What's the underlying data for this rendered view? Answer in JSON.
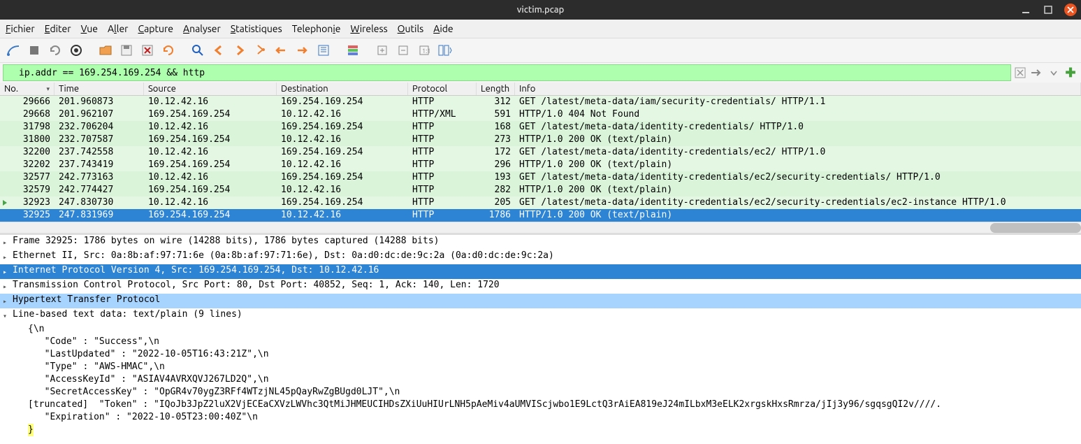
{
  "window": {
    "title": "victim.pcap"
  },
  "menu": {
    "fichier": "Fichier",
    "editer": "Editer",
    "vue": "Vue",
    "aller": "Aller",
    "capture": "Capture",
    "analyser": "Analyser",
    "statistiques": "Statistiques",
    "telephonie": "Telephonie",
    "wireless": "Wireless",
    "outils": "Outils",
    "aide": "Aide"
  },
  "filter": {
    "expression": "ip.addr == 169.254.169.254 && http"
  },
  "columns": {
    "no": "No.",
    "time": "Time",
    "source": "Source",
    "destination": "Destination",
    "protocol": "Protocol",
    "length": "Length",
    "info": "Info"
  },
  "packets": [
    {
      "no": "29666",
      "time": "201.960873",
      "src": "10.12.42.16",
      "dst": "169.254.169.254",
      "proto": "HTTP",
      "len": "312",
      "info": "GET /latest/meta-data/iam/security-credentials/ HTTP/1.1",
      "cls": "row-green"
    },
    {
      "no": "29668",
      "time": "201.962107",
      "src": "169.254.169.254",
      "dst": "10.12.42.16",
      "proto": "HTTP/XML",
      "len": "591",
      "info": "HTTP/1.0 404 Not Found",
      "cls": "row-green"
    },
    {
      "no": "31798",
      "time": "232.706204",
      "src": "10.12.42.16",
      "dst": "169.254.169.254",
      "proto": "HTTP",
      "len": "168",
      "info": "GET /latest/meta-data/identity-credentials/ HTTP/1.0",
      "cls": "row-lgreen"
    },
    {
      "no": "31800",
      "time": "232.707587",
      "src": "169.254.169.254",
      "dst": "10.12.42.16",
      "proto": "HTTP",
      "len": "273",
      "info": "HTTP/1.0 200 OK  (text/plain)",
      "cls": "row-lgreen"
    },
    {
      "no": "32200",
      "time": "237.742558",
      "src": "10.12.42.16",
      "dst": "169.254.169.254",
      "proto": "HTTP",
      "len": "172",
      "info": "GET /latest/meta-data/identity-credentials/ec2/ HTTP/1.0",
      "cls": "row-green"
    },
    {
      "no": "32202",
      "time": "237.743419",
      "src": "169.254.169.254",
      "dst": "10.12.42.16",
      "proto": "HTTP",
      "len": "296",
      "info": "HTTP/1.0 200 OK  (text/plain)",
      "cls": "row-green"
    },
    {
      "no": "32577",
      "time": "242.773163",
      "src": "10.12.42.16",
      "dst": "169.254.169.254",
      "proto": "HTTP",
      "len": "193",
      "info": "GET /latest/meta-data/identity-credentials/ec2/security-credentials/ HTTP/1.0",
      "cls": "row-lgreen"
    },
    {
      "no": "32579",
      "time": "242.774427",
      "src": "169.254.169.254",
      "dst": "10.12.42.16",
      "proto": "HTTP",
      "len": "282",
      "info": "HTTP/1.0 200 OK  (text/plain)",
      "cls": "row-lgreen"
    },
    {
      "no": "32923",
      "time": "247.830730",
      "src": "10.12.42.16",
      "dst": "169.254.169.254",
      "proto": "HTTP",
      "len": "205",
      "info": "GET /latest/meta-data/identity-credentials/ec2/security-credentials/ec2-instance HTTP/1.0",
      "cls": "row-current"
    },
    {
      "no": "32925",
      "time": "247.831969",
      "src": "169.254.169.254",
      "dst": "10.12.42.16",
      "proto": "HTTP",
      "len": "1786",
      "info": "HTTP/1.0 200 OK  (text/plain)",
      "cls": "row-selected"
    }
  ],
  "details": {
    "frame": "Frame 32925: 1786 bytes on wire (14288 bits), 1786 bytes captured (14288 bits)",
    "eth": "Ethernet II, Src: 0a:8b:af:97:71:6e (0a:8b:af:97:71:6e), Dst: 0a:d0:dc:de:9c:2a (0a:d0:dc:de:9c:2a)",
    "ip": "Internet Protocol Version 4, Src: 169.254.169.254, Dst: 10.12.42.16",
    "tcp": "Transmission Control Protocol, Src Port: 80, Dst Port: 40852, Seq: 1, Ack: 140, Len: 1720",
    "http": "Hypertext Transfer Protocol",
    "lbtd": "Line-based text data: text/plain (9 lines)",
    "body": {
      "open": "{\\n",
      "code": "  \"Code\" : \"Success\",\\n",
      "lastUpdated": "  \"LastUpdated\" : \"2022-10-05T16:43:21Z\",\\n",
      "type": "  \"Type\" : \"AWS-HMAC\",\\n",
      "akid": "  \"AccessKeyId\" : \"ASIAV4AVRXQVJ267LD2Q\",\\n",
      "sak": "  \"SecretAccessKey\" : \"OpGR4v70ygZ3RFf4WTzjNL45pQayRwZgBUgd0LJT\",\\n",
      "token": "[truncated]  \"Token\" : \"IQoJb3JpZ2luX2VjECEaCXVzLWVhc3QtMiJHMEUCIHDsZXiUuHIUrLNH5pAeMiv4aUMVIScjwbo1E9LctQ3rAiEA819eJ24mILbxM3eELK2xrgskHxsRmrza/jIj3y96/sgqsgQI2v////.",
      "exp": "  \"Expiration\" : \"2022-10-05T23:00:40Z\"\\n",
      "close": "}"
    }
  }
}
